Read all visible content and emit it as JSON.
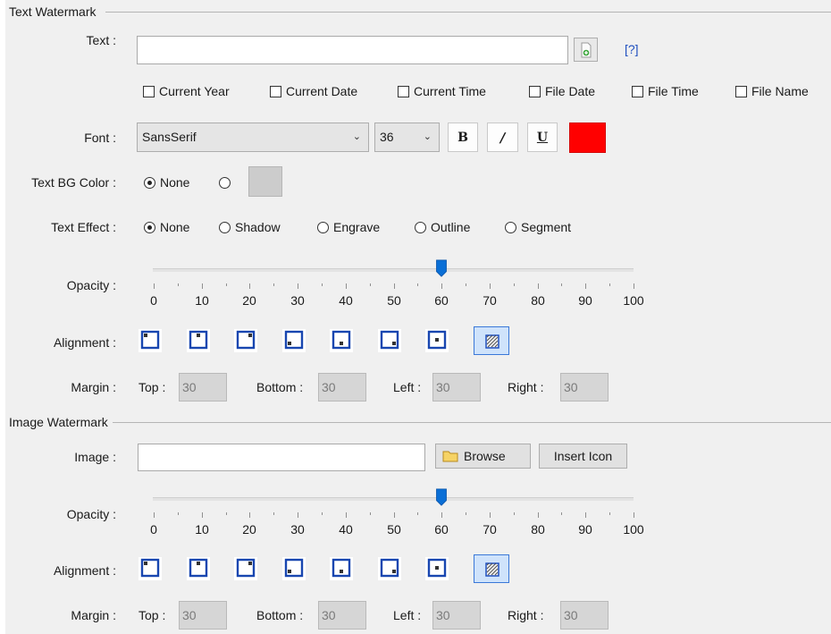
{
  "text_watermark": {
    "section_title": "Text Watermark",
    "text_label": "Text :",
    "text_value": "",
    "help_link": "[?]",
    "insert_icon": "insert-file-icon",
    "checkboxes": [
      "Current Year",
      "Current Date",
      "Current Time",
      "File Date",
      "File Time",
      "File Name"
    ],
    "font_label": "Font :",
    "font_family": "SansSerif",
    "font_size": "36",
    "bold_label": "B",
    "italic_label": "I",
    "underline_label": "U",
    "font_color": "#ff0000",
    "bg_label": "Text BG Color :",
    "bg_none": "None",
    "bg_swatch_color": "#cccccc",
    "effect_label": "Text Effect :",
    "effects": [
      "None",
      "Shadow",
      "Engrave",
      "Outline",
      "Segment"
    ],
    "opacity_label": "Opacity :",
    "opacity_value": 60,
    "opacity_ticks": [
      "0",
      "10",
      "20",
      "30",
      "40",
      "50",
      "60",
      "70",
      "80",
      "90",
      "100"
    ],
    "alignment_label": "Alignment :",
    "margin_label": "Margin :",
    "margin_top_label": "Top :",
    "margin_top": "30",
    "margin_bottom_label": "Bottom :",
    "margin_bottom": "30",
    "margin_left_label": "Left :",
    "margin_left": "30",
    "margin_right_label": "Right :",
    "margin_right": "30"
  },
  "image_watermark": {
    "section_title": "Image Watermark",
    "image_label": "Image :",
    "image_value": "",
    "browse_label": "Browse",
    "insert_icon_label": "Insert Icon",
    "opacity_label": "Opacity :",
    "opacity_value": 60,
    "opacity_ticks": [
      "0",
      "10",
      "20",
      "30",
      "40",
      "50",
      "60",
      "70",
      "80",
      "90",
      "100"
    ],
    "alignment_label": "Alignment :",
    "margin_label": "Margin :",
    "margin_top_label": "Top :",
    "margin_top": "30",
    "margin_bottom_label": "Bottom :",
    "margin_bottom": "30",
    "margin_left_label": "Left :",
    "margin_left": "30",
    "margin_right_label": "Right :",
    "margin_right": "30"
  },
  "alignment_positions": [
    "top-left",
    "top-center",
    "top-right",
    "bottom-left",
    "bottom-center",
    "bottom-right",
    "center",
    "tile"
  ],
  "accent_color": "#0a6fd6"
}
